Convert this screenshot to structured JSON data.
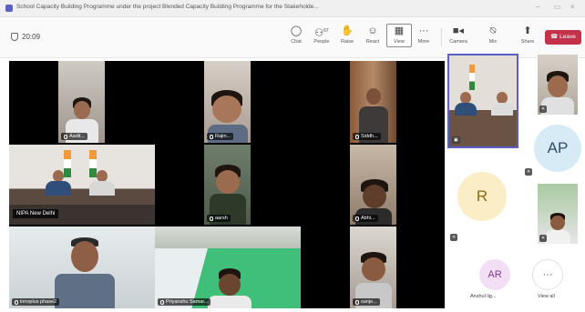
{
  "window": {
    "title": "School Capacity Building Programme under the project Blended Capacity Building Programme for the Stakeholde...",
    "controls": {
      "minimize": "–",
      "maximize": "▭",
      "close": "×"
    }
  },
  "meeting": {
    "timer": "20:09"
  },
  "toolbar": {
    "chat": "Chat",
    "people": "People",
    "people_count": "67",
    "raise": "Raise",
    "react": "React",
    "view": "View",
    "more": "More",
    "camera": "Camera",
    "mic": "Mic",
    "share": "Share",
    "leave": "Leave"
  },
  "participants": {
    "aadit": "Aadit...",
    "rajin": "Rajin...",
    "siddh": "Siddh...",
    "niipa": "NIPA New Delhi",
    "aarsh": "aarsh",
    "abhi": "Abhi...",
    "innoplus": "innoplus phase2",
    "priyanshu": "Priyanshu Samar...",
    "sanje": "sanje..."
  },
  "side": {
    "ap": "AP",
    "r": "R",
    "ar": "AR",
    "more_dots": "···",
    "more_people_label": "View all",
    "ar_name": "Anshul lig..."
  },
  "colors": {
    "brand": "#5b5fc7",
    "leave": "#c4314b",
    "ap_bg": "#d6ebf5",
    "r_bg": "#fbeec6",
    "ar_bg": "#f3dff5"
  }
}
